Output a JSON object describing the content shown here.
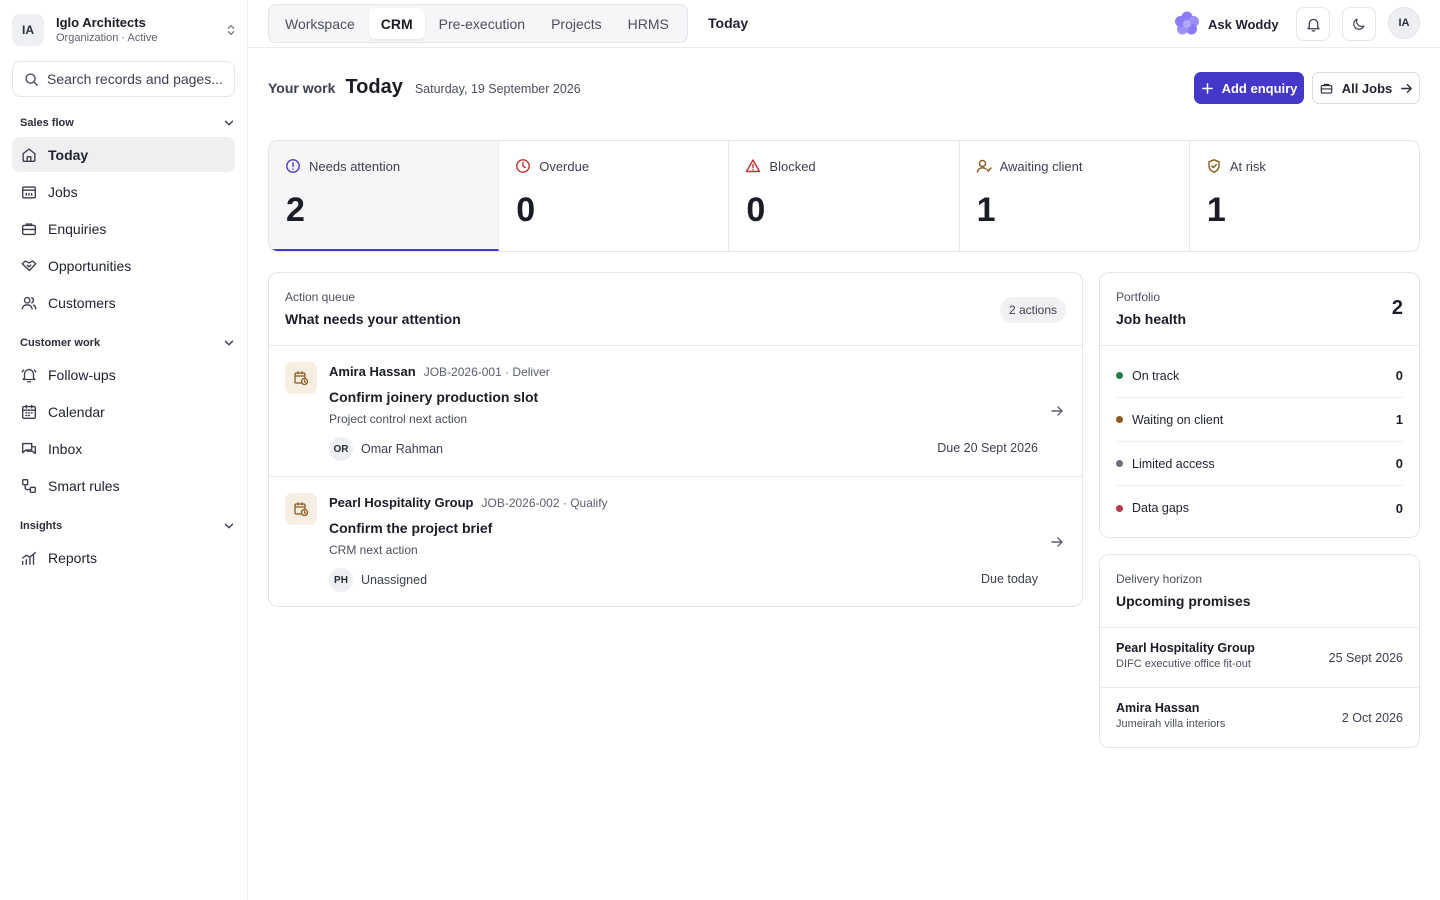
{
  "org": {
    "initials": "IA",
    "name": "Iglo Architects",
    "subtitle": "Organization · Active"
  },
  "search": {
    "placeholder": "Search records and pages..."
  },
  "sidebar": {
    "sections": [
      {
        "title": "Sales flow",
        "items": [
          {
            "label": "Today",
            "icon": "home-icon",
            "active": true
          },
          {
            "label": "Jobs",
            "icon": "jobs-icon"
          },
          {
            "label": "Enquiries",
            "icon": "inbox-tray-icon"
          },
          {
            "label": "Opportunities",
            "icon": "handshake-icon"
          },
          {
            "label": "Customers",
            "icon": "users-icon"
          }
        ]
      },
      {
        "title": "Customer work",
        "items": [
          {
            "label": "Follow-ups",
            "icon": "bell-ring-icon"
          },
          {
            "label": "Calendar",
            "icon": "calendar-icon"
          },
          {
            "label": "Inbox",
            "icon": "messages-icon"
          },
          {
            "label": "Smart rules",
            "icon": "workflow-icon"
          }
        ]
      },
      {
        "title": "Insights",
        "items": [
          {
            "label": "Reports",
            "icon": "chart-icon"
          }
        ]
      }
    ]
  },
  "topbar": {
    "tabs": [
      "Workspace",
      "CRM",
      "Pre-execution",
      "Projects",
      "HRMS"
    ],
    "active_tab": "CRM",
    "crumb": "Today",
    "ask_label": "Ask Woddy",
    "user_initials": "IA"
  },
  "page": {
    "your_work": "Your work",
    "title": "Today",
    "date": "Saturday, 19 September 2026",
    "add_enquiry": "Add enquiry",
    "all_jobs": "All Jobs"
  },
  "stats": [
    {
      "label": "Needs attention",
      "value": "2",
      "icon": "info-circle-icon",
      "color": "#4338ca"
    },
    {
      "label": "Overdue",
      "value": "0",
      "icon": "clock-icon",
      "color": "#c53030"
    },
    {
      "label": "Blocked",
      "value": "0",
      "icon": "warning-triangle-icon",
      "color": "#c53030"
    },
    {
      "label": "Awaiting client",
      "value": "1",
      "icon": "user-waiting-icon",
      "color": "#8a5a1e"
    },
    {
      "label": "At risk",
      "value": "1",
      "icon": "shield-icon",
      "color": "#8a5a1e"
    }
  ],
  "queue": {
    "kicker": "Action queue",
    "title": "What needs your attention",
    "badge": "2 actions",
    "items": [
      {
        "client": "Amira Hassan",
        "meta": "JOB-2026-001 · Deliver",
        "title": "Confirm joinery production slot",
        "sub": "Project control next action",
        "owner_initials": "OR",
        "owner": "Omar Rahman",
        "due": "Due 20 Sept 2026"
      },
      {
        "client": "Pearl Hospitality Group",
        "meta": "JOB-2026-002 · Qualify",
        "title": "Confirm the project brief",
        "sub": "CRM next action",
        "owner_initials": "PH",
        "owner": "Unassigned",
        "due": "Due today"
      }
    ]
  },
  "portfolio": {
    "kicker": "Portfolio",
    "title": "Job health",
    "total": "2",
    "rows": [
      {
        "label": "On track",
        "count": "0",
        "color": "#1a7f4b"
      },
      {
        "label": "Waiting on client",
        "count": "1",
        "color": "#8a5a1e"
      },
      {
        "label": "Limited access",
        "count": "0",
        "color": "#6b6f7c"
      },
      {
        "label": "Data gaps",
        "count": "0",
        "color": "#b83a4b"
      }
    ]
  },
  "delivery": {
    "kicker": "Delivery horizon",
    "title": "Upcoming promises",
    "items": [
      {
        "client": "Pearl Hospitality Group",
        "project": "DIFC executive office fit-out",
        "date": "25 Sept 2026"
      },
      {
        "client": "Amira Hassan",
        "project": "Jumeirah villa interiors",
        "date": "2 Oct 2026"
      }
    ]
  },
  "colors": {
    "accent": "#4338ca",
    "border": "#e4e5ea"
  }
}
